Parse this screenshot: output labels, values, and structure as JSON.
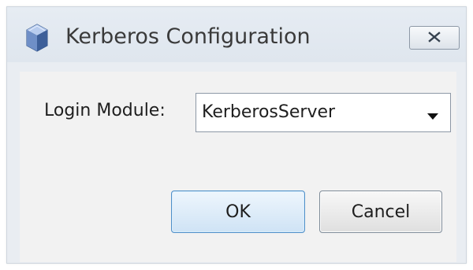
{
  "window": {
    "title": "Kerberos Configuration",
    "icon": "cube-icon"
  },
  "form": {
    "login_module_label": "Login Module:",
    "login_module_value": "KerberosServer"
  },
  "buttons": {
    "ok_label": "OK",
    "cancel_label": "Cancel"
  },
  "colors": {
    "dialog_background": "#e9edf2",
    "content_background": "#f2f2f2",
    "ok_button_accent": "#4f8fc8"
  }
}
